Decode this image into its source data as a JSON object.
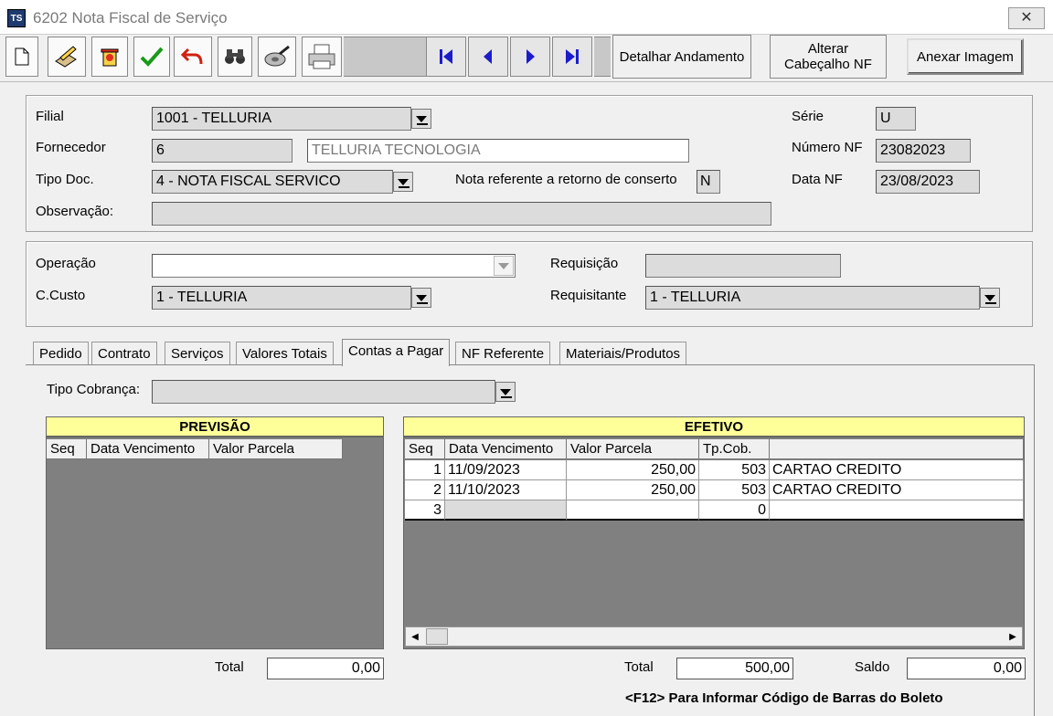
{
  "window": {
    "title": "6202 Nota Fiscal de Serviço",
    "icon_text": "TS",
    "close_label": "✕"
  },
  "toolbar": {
    "icons": [
      "new-document-icon",
      "edit-icon",
      "delete-icon",
      "confirm-check-icon",
      "undo-icon",
      "search-binoculars-icon",
      "attach-disc-icon",
      "print-icon"
    ],
    "nav": [
      "first-record-icon",
      "prev-record-icon",
      "next-record-icon",
      "last-record-icon"
    ],
    "detalhar_label": "Detalhar Andamento",
    "alterar_label_1": "Alterar",
    "alterar_label_2": "Cabeçalho NF",
    "anexar_label": "Anexar Imagem"
  },
  "header": {
    "filial_label": "Filial",
    "filial_value": "1001 - TELLURIA",
    "fornecedor_label": "Fornecedor",
    "fornecedor_code": "6",
    "fornecedor_name": "TELLURIA TECNOLOGIA",
    "tipodoc_label": "Tipo Doc.",
    "tipodoc_value": "4 - NOTA FISCAL SERVICO",
    "retorno_label": "Nota referente a  retorno de conserto",
    "retorno_value": "N",
    "obs_label": "Observação:",
    "obs_value": "",
    "serie_label": "Série",
    "serie_value": "U",
    "numero_label": "Número NF",
    "numero_value": "23082023",
    "data_label": "Data NF",
    "data_value": "23/08/2023"
  },
  "operacao": {
    "operacao_label": "Operação",
    "operacao_value": "",
    "ccusto_label": "C.Custo",
    "ccusto_value": "1 - TELLURIA",
    "requisicao_label": "Requisição",
    "requisicao_value": "",
    "requisitante_label": "Requisitante",
    "requisitante_value": "1 - TELLURIA"
  },
  "tabs": [
    "Pedido",
    "Contrato",
    "Serviços",
    "Valores Totais",
    "Contas a Pagar",
    "NF Referente",
    "Materiais/Produtos"
  ],
  "active_tab": "Contas a Pagar",
  "contas": {
    "tipo_cobranca_label": "Tipo Cobrança:",
    "tipo_cobranca_value": "",
    "previsao": {
      "title": "PREVISÃO",
      "columns": [
        "Seq",
        "Data Vencimento",
        "Valor Parcela"
      ],
      "total_label": "Total",
      "total_value": "0,00"
    },
    "efetivo": {
      "title": "EFETIVO",
      "columns": [
        "Seq",
        "Data Vencimento",
        "Valor Parcela",
        "Tp.Cob.",
        ""
      ],
      "rows": [
        {
          "seq": "1",
          "data": "11/09/2023",
          "valor": "250,00",
          "tp": "503",
          "desc": "CARTAO CREDITO"
        },
        {
          "seq": "2",
          "data": "11/10/2023",
          "valor": "250,00",
          "tp": "503",
          "desc": "CARTAO CREDITO"
        },
        {
          "seq": "3",
          "data": "",
          "valor": "",
          "tp": "0",
          "desc": ""
        }
      ],
      "total_label": "Total",
      "total_value": "500,00",
      "saldo_label": "Saldo",
      "saldo_value": "0,00"
    },
    "hint": "<F12> Para Informar Código de Barras do Boleto"
  }
}
